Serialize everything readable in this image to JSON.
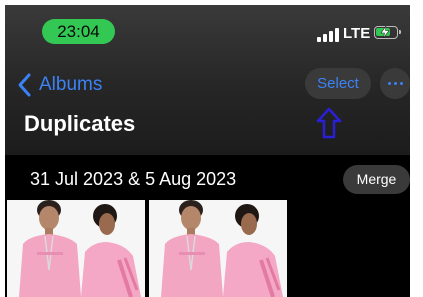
{
  "status_bar": {
    "time": "23:04",
    "network": "LTE"
  },
  "nav": {
    "back_label": "Albums",
    "select_label": "Select"
  },
  "page": {
    "title": "Duplicates"
  },
  "group": {
    "date_range": "31 Jul 2023 & 5 Aug 2023",
    "merge_label": "Merge"
  },
  "icons": {
    "back": "chevron-left-icon",
    "more": "ellipsis-icon",
    "annotation": "up-arrow-icon",
    "signal": "signal-bars-icon",
    "battery": "battery-charging-icon"
  },
  "colors": {
    "accent": "#3b82f6",
    "time_pill": "#32c853",
    "annotation_arrow": "#2a1fd6"
  }
}
